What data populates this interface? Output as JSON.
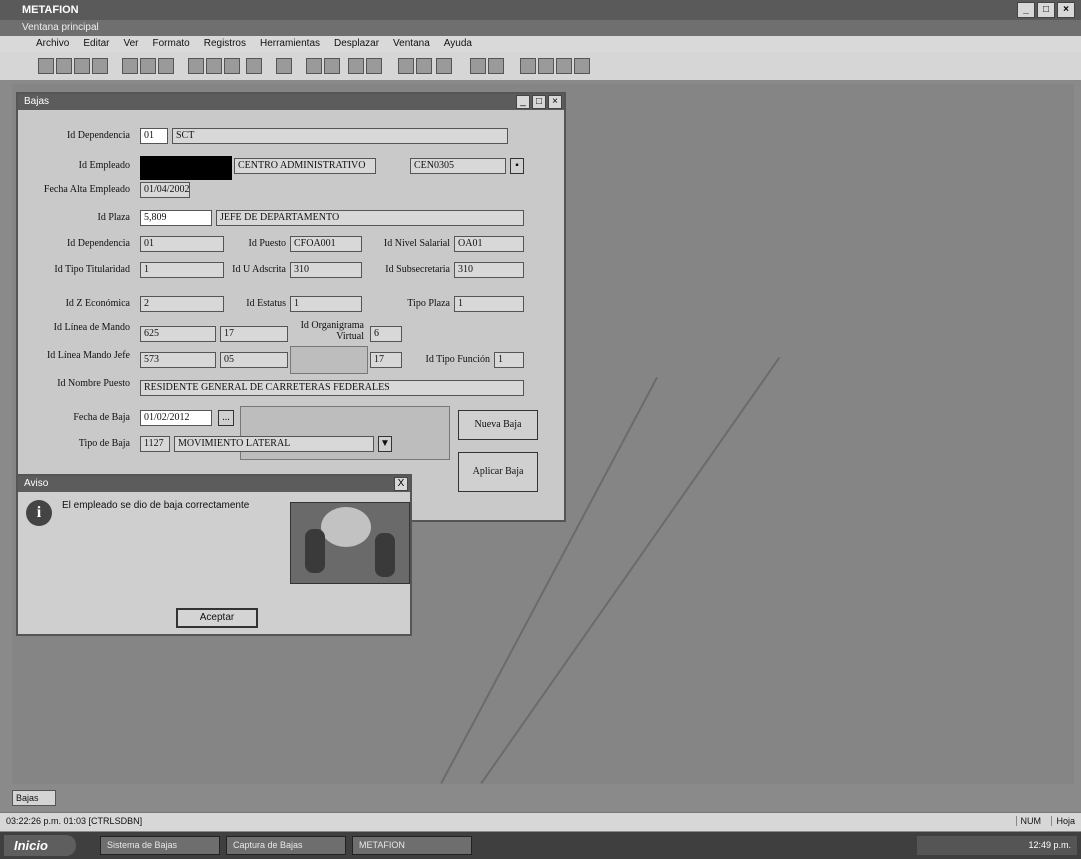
{
  "app": {
    "title": "METAFION",
    "subtitle": "Ventana principal"
  },
  "menu": [
    "Archivo",
    "Editar",
    "Ver",
    "Formato",
    "Registros",
    "Herramientas",
    "Desplazar",
    "Ventana",
    "Ayuda"
  ],
  "form": {
    "title": "Bajas",
    "labels": {
      "dependencia_top": "Id Dependencia",
      "empleado": "Id Empleado",
      "fecha_alta": "Fecha Alta Empleado",
      "plaza": "Id Plaza",
      "dependencia": "Id Dependencia",
      "puesto": "Id Puesto",
      "nivel_salarial": "Id Nivel Salarial",
      "tipo_titularidad": "Id Tipo Titularidad",
      "ur_adscrita": "Id U Adscrita",
      "subsecretaria": "Id Subsecretaria",
      "zona_economica": "Id Z Económica",
      "estatus": "Id Estatus",
      "tipo_plaza": "Tipo Plaza",
      "linea_mando": "Id Línea de Mando",
      "organigrama_virtual": "Id Organigrama Virtual",
      "linea_mando_jefe": "Id Línea Mando Jefe",
      "tipo_funcion": "Id Tipo Función",
      "nombre_puesto": "Id Nombre Puesto",
      "fecha_baja": "Fecha de Baja",
      "tipo_baja": "Tipo de Baja"
    },
    "values": {
      "dependencia_top_id": "01",
      "dependencia_top_name": "SCT",
      "empleado_name": "CENTRO ADMINISTRATIVO",
      "empleado_code": "CEN0305",
      "fecha_alta": "01/04/2002",
      "plaza_id": "5,809",
      "plaza_name": "JEFE DE DEPARTAMENTO",
      "dependencia": "01",
      "puesto": "CFOA001",
      "nivel_salarial": "OA01",
      "tipo_titularidad": "1",
      "ur_adscrita": "310",
      "subsecretaria": "310",
      "zona_economica": "2",
      "estatus": "1",
      "tipo_plaza": "1",
      "linea_mando_a": "625",
      "linea_mando_b": "17",
      "organigrama": "6",
      "linea_jefe_a": "573",
      "linea_jefe_b": "05",
      "linea_jefe_c": "17",
      "tipo_funcion": "1",
      "nombre_puesto": "RESIDENTE GENERAL DE CARRETERAS FEDERALES",
      "fecha_baja": "01/02/2012",
      "tipo_baja_id": "1127",
      "tipo_baja_name": "MOVIMIENTO LATERAL"
    },
    "buttons": {
      "nueva_baja": "Nueva Baja",
      "aplicar_baja": "Aplicar Baja",
      "calendar": "..."
    }
  },
  "dialog": {
    "title": "Aviso",
    "message": "El empleado se dio de baja correctamente",
    "ok": "Aceptar",
    "close": "X"
  },
  "minimized": {
    "label": "Bajas"
  },
  "status": {
    "left": "03:22:26 p.m. 01:03 [CTRLSDBN]",
    "right": "NUM",
    "mode": "Hoja"
  },
  "taskbar": {
    "start": "Inicio",
    "items": [
      "Sistema de Bajas",
      "Captura de Bajas",
      "METAFION"
    ],
    "clock": "12:49 p.m."
  }
}
